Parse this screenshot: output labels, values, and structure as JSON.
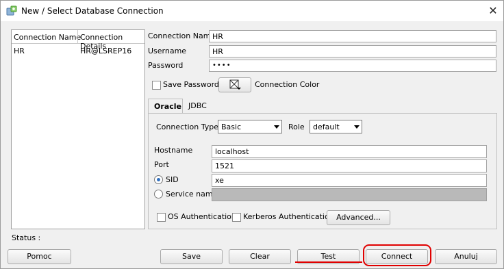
{
  "window": {
    "title": "New / Select Database Connection",
    "close_glyph": "✕"
  },
  "connections": {
    "columns": [
      "Connection Name",
      "Connection Details"
    ],
    "rows": [
      {
        "name": "HR",
        "details": "HR@LSREP16"
      }
    ]
  },
  "form": {
    "connection_name_label": "Connection Name",
    "connection_name_value": "HR",
    "username_label": "Username",
    "username_value": "HR",
    "password_label": "Password",
    "password_value": "••••",
    "save_password_label": "Save Password",
    "connection_color_label": "Connection Color"
  },
  "tabs": [
    {
      "label": "Oracle",
      "active": true
    },
    {
      "label": "JDBC",
      "active": false
    }
  ],
  "oracle": {
    "connection_type_label": "Connection Type",
    "connection_type_value": "Basic",
    "role_label": "Role",
    "role_value": "default",
    "hostname_label": "Hostname",
    "hostname_value": "localhost",
    "port_label": "Port",
    "port_value": "1521",
    "sid_label": "SID",
    "sid_value": "xe",
    "service_name_label": "Service name",
    "os_auth_label": "OS Authentication",
    "kerberos_label": "Kerberos Authentication",
    "advanced_label": "Advanced..."
  },
  "status_label": "Status :",
  "buttons": {
    "help": "Pomoc",
    "save": "Save",
    "clear": "Clear",
    "test": "Test",
    "connect": "Connect",
    "cancel": "Anuluj"
  },
  "colors": {
    "highlight": "#e00000"
  }
}
